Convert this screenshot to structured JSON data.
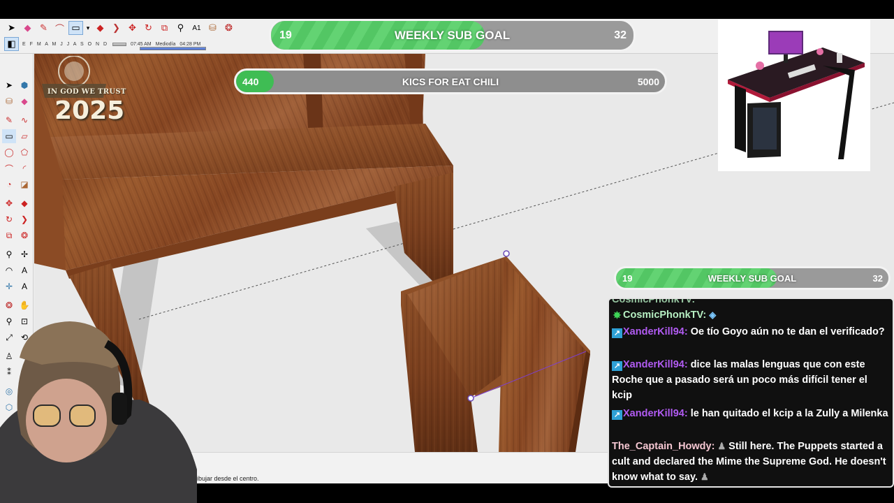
{
  "app": {
    "status_text": "ibujar desde el centro.",
    "shadow_time_start": "07:45 AM",
    "shadow_mid": "Mediodía",
    "shadow_time_end": "04:28 PM",
    "shadow_months": "E F M A M J J A S O N D"
  },
  "badge": {
    "line1": "IN GOD WE TRUST",
    "line2": "2025"
  },
  "goals": {
    "weekly_sub": {
      "current": "19",
      "label": "WEEKLY SUB GOAL",
      "target": "32",
      "fraction": 0.59
    },
    "kics": {
      "current": "440",
      "label": "KICS FOR EAT CHILI",
      "target": "5000",
      "fraction": 0.088
    },
    "weekly_sub_chat": {
      "current": "19",
      "label": "WEEKLY SUB GOAL",
      "target": "32",
      "fraction": 0.59
    }
  },
  "chat": {
    "messages": [
      {
        "user": "CosmicPhonkTV:",
        "text": "",
        "badge": "mod-icon",
        "color": "#b7f0c3"
      },
      {
        "user": "XanderKill94:",
        "text": "Oe tío Goyo aún no te dan el verificado?",
        "badge": "sub-icon",
        "color": "#b15bf2"
      },
      {
        "user": "XanderKill94:",
        "text": "dice las malas lenguas que con este Roche que a pasado será un poco más difícil tener el kcip",
        "badge": "sub-icon",
        "color": "#b15bf2"
      },
      {
        "user": "XanderKill94:",
        "text": "le han quitado el kcip a la Zully a Milenka",
        "badge": "sub-icon",
        "color": "#b15bf2"
      },
      {
        "user": "The_Captain_Howdy:",
        "text": "Still here. The Puppets started a cult and declared the Mime the Supreme God. He doesn't know what to say.",
        "badge": "",
        "color": "#f5c7d2"
      }
    ]
  },
  "colors": {
    "goal_fill": "#53c664",
    "kics_fill": "#3fbd54",
    "goal_track": "#9a9a9a",
    "wood": "#8a4a24",
    "chat_bg": "#101010"
  }
}
